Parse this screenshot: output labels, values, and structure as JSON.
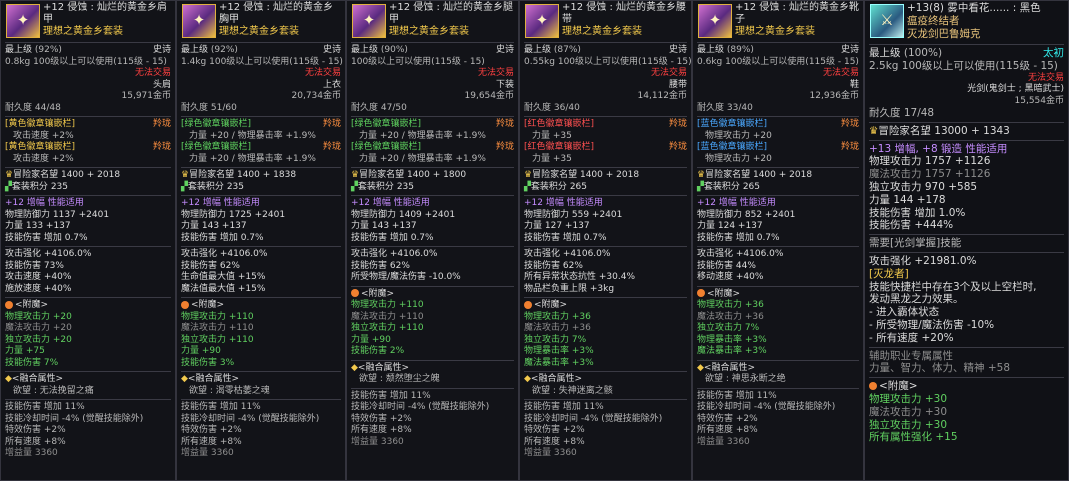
{
  "common": {
    "level": "最上级",
    "req": "100级以上可以使用(115级 - 15)",
    "untradable": "无法交易",
    "durability_label": "耐久度",
    "socket_label": "羚珑",
    "attack_speed": "攻击速度 +2%",
    "adv_name": "冒险家名望",
    "set_points": "套装积分",
    "enchant": "<附魔>",
    "fusion": "<融合属性>",
    "fusion_skill1": "技能伤害 增加 11%",
    "fusion_skill2": "技能冷却时间 -4% (觉醒技能除外)",
    "fusion_skill3": "特效伤害 +2%",
    "fusion_skill4": "所有速度 +8%",
    "weight_boost": "增益量 3360"
  },
  "panels": [
    {
      "title": "+12 侵蚀 : 灿烂的黄金乡肩甲",
      "set": "理想之黄金乡套装",
      "pct": "(92%)",
      "rarity": "史诗",
      "weight": "0.8kg",
      "slot": "头肩",
      "price": "15,971金币",
      "dura": "44/48",
      "emblem_type": "[黄色徽章镶嵌栏]",
      "emb1": "攻击速度 +2%",
      "emb2": "攻击速度 +2%",
      "adv": "1400 + 2018",
      "points": "235",
      "amp": "+12 增幅 性能适用",
      "base1": "物理防御力 1137 +2401",
      "base2": "力量 133 +137",
      "base3": "技能伤害 增加 0.7%",
      "stats": [
        "攻击强化 +4106.0%",
        "技能伤害 73%",
        "攻击速度 +40%",
        "施放速度 +40%"
      ],
      "ench": [
        "物理攻击力 +20",
        "魔法攻击力 +20",
        "独立攻击力 +20",
        "力量 +75",
        "技能伤害 7%"
      ],
      "desire": "欲望 : 无法挽留之痛"
    },
    {
      "title": "+12 侵蚀 : 灿烂的黄金乡胸甲",
      "set": "理想之黄金乡套装",
      "pct": "(92%)",
      "rarity": "史诗",
      "weight": "1.4kg",
      "slot": "上衣",
      "price": "20,734金币",
      "dura": "51/60",
      "emblem_type": "[绿色徽章镶嵌栏]",
      "emb1": "力量 +20 / 物理暴击率 +1.9%",
      "emb2": "力量 +20 / 物理暴击率 +1.9%",
      "adv": "1400 + 1838",
      "points": "235",
      "amp": "+12 增幅 性能适用",
      "base1": "物理防御力 1725 +2401",
      "base2": "力量 143 +137",
      "base3": "技能伤害 增加 0.7%",
      "stats": [
        "攻击强化 +4106.0%",
        "技能伤害 62%",
        "生命值最大值 +15%",
        "魔法值最大值 +15%"
      ],
      "ench": [
        "物理攻击力 +110",
        "魔法攻击力 +110",
        "独立攻击力 +110",
        "力量 +90",
        "技能伤害 3%"
      ],
      "desire": "欲望 : 渴零枯萎之魂"
    },
    {
      "title": "+12 侵蚀 : 灿烂的黄金乡腿甲",
      "set": "理想之黄金乡套装",
      "pct": "(90%)",
      "rarity": "史诗",
      "weight": "",
      "slot": "下装",
      "price": "19,654金币",
      "dura": "47/50",
      "emblem_type": "[绿色徽章镶嵌栏]",
      "emb1": "力量 +20 / 物理暴击率 +1.9%",
      "emb2": "力量 +20 / 物理暴击率 +1.9%",
      "adv": "1400 + 1800",
      "points": "235",
      "amp": "+12 增幅 性能适用",
      "base1": "物理防御力 1409 +2401",
      "base2": "力量 143 +137",
      "base3": "技能伤害 增加 0.7%",
      "stats": [
        "攻击强化 +4106.0%",
        "技能伤害 62%",
        "所受物理/魔法伤害 -10.0%"
      ],
      "ench": [
        "物理攻击力 +110",
        "魔法攻击力 +110",
        "独立攻击力 +110",
        "力量 +90",
        "技能伤害 2%"
      ],
      "desire": "欲望 : 颓然堕尘之魄"
    },
    {
      "title": "+12 侵蚀 : 灿烂的黄金乡腰带",
      "set": "理想之黄金乡套装",
      "pct": "(87%)",
      "rarity": "史诗",
      "weight": "0.55kg",
      "slot": "腰带",
      "price": "14,112金币",
      "dura": "36/40",
      "emblem_type": "[红色徽章镶嵌栏]",
      "emb1": "力量 +35",
      "emb2": "力量 +35",
      "adv": "1400 + 2018",
      "points": "265",
      "amp": "+12 增幅 性能适用",
      "base1": "物理防御力 559 +2401",
      "base2": "力量 127 +137",
      "base3": "技能伤害 增加 0.7%",
      "stats": [
        "攻击强化 +4106.0%",
        "技能伤害 62%",
        "所有异常状态抗性 +30.4%",
        "物品栏负重上限 +3kg"
      ],
      "ench": [
        "物理攻击力 +36",
        "魔法攻击力 +36",
        "独立攻击力 7%",
        "物理暴击率 +3%",
        "魔法暴击率 +3%"
      ],
      "desire": "欲望 : 失神迷离之骸"
    },
    {
      "title": "+12 侵蚀 : 灿烂的黄金乡靴子",
      "set": "理想之黄金乡套装",
      "pct": "(89%)",
      "rarity": "史诗",
      "weight": "0.6kg",
      "slot": "鞋",
      "price": "12,936金币",
      "dura": "33/40",
      "emblem_type": "[蓝色徽章镶嵌栏]",
      "emb1": "物理攻击力 +20",
      "emb2": "物理攻击力 +20",
      "adv": "1400 + 2018",
      "points": "265",
      "amp": "+12 增幅 性能适用",
      "base1": "物理防御力 852 +2401",
      "base2": "力量 124 +137",
      "base3": "技能伤害 增加 0.7%",
      "stats": [
        "攻击强化 +4106.0%",
        "技能伤害 44%",
        "移动速度 +40%"
      ],
      "ench": [
        "物理攻击力 +36",
        "魔法攻击力 +36",
        "独立攻击力 7%",
        "物理暴击率 +3%",
        "魔法暴击率 +3%"
      ],
      "desire": "欲望 : 神思永断之绝"
    }
  ],
  "weapon": {
    "title1": "+13(8) 雾中看花...... : 黑色",
    "title2": "瘟疫终结者",
    "set": "灭龙剑巴鲁姆克",
    "level": "最上级",
    "pct": "(100%)",
    "rarity": "太初",
    "weight": "2.5kg",
    "req": "100级以上可以使用(115级 - 15)",
    "untradable": "无法交易",
    "cls": "光剑(鬼剑士 ; 黑暗武士)",
    "price": "15,554金币",
    "dura": "耐久度 17/48",
    "adv": "冒险家名望 13000 + 1343",
    "amp": "+13 增幅, +8 锻造 性能适用",
    "l1": "物理攻击力 1757 +1126",
    "l2": "魔法攻击力 1757 +1126",
    "l3": "独立攻击力 970 +585",
    "l4": "力量 144 +178",
    "l5": "技能伤害 增加 1.0%",
    "l6": "技能伤害 +444%",
    "need": "需要[光剑掌握]技能",
    "atk": "攻击强化 +21981.0%",
    "ex_title": "[灭龙者]",
    "ex1": "技能快捷栏中存在3个及以上空栏时,",
    "ex2": "发动黑龙之力效果。",
    "ex3": "- 进入霸体状态",
    "ex4": "- 所受物理/魔法伤害 -10%",
    "ex5": "- 所有速度 +20%",
    "aux": "辅助职业专属属性",
    "aux2": "力量、智力、体力、精神 +58",
    "ench": "<附魔>",
    "e1": "物理攻击力 +30",
    "e2": "魔法攻击力 +30",
    "e3": "独立攻击力 +30",
    "e4": "所有属性强化 +15"
  }
}
